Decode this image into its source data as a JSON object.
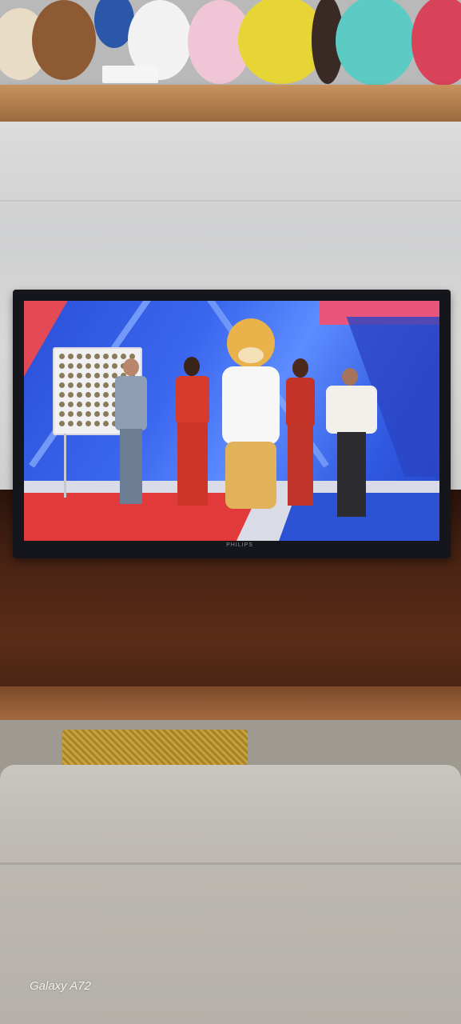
{
  "scene": {
    "tv_brand": "PHILIPS",
    "watermark": "Galaxy A72"
  },
  "colors": {
    "table": "#4b2414",
    "tv_bezel": "#14161c",
    "screen_blue": "#3a67ee",
    "stage_red": "#e23a3a",
    "sofa": "#bdb9b2"
  }
}
